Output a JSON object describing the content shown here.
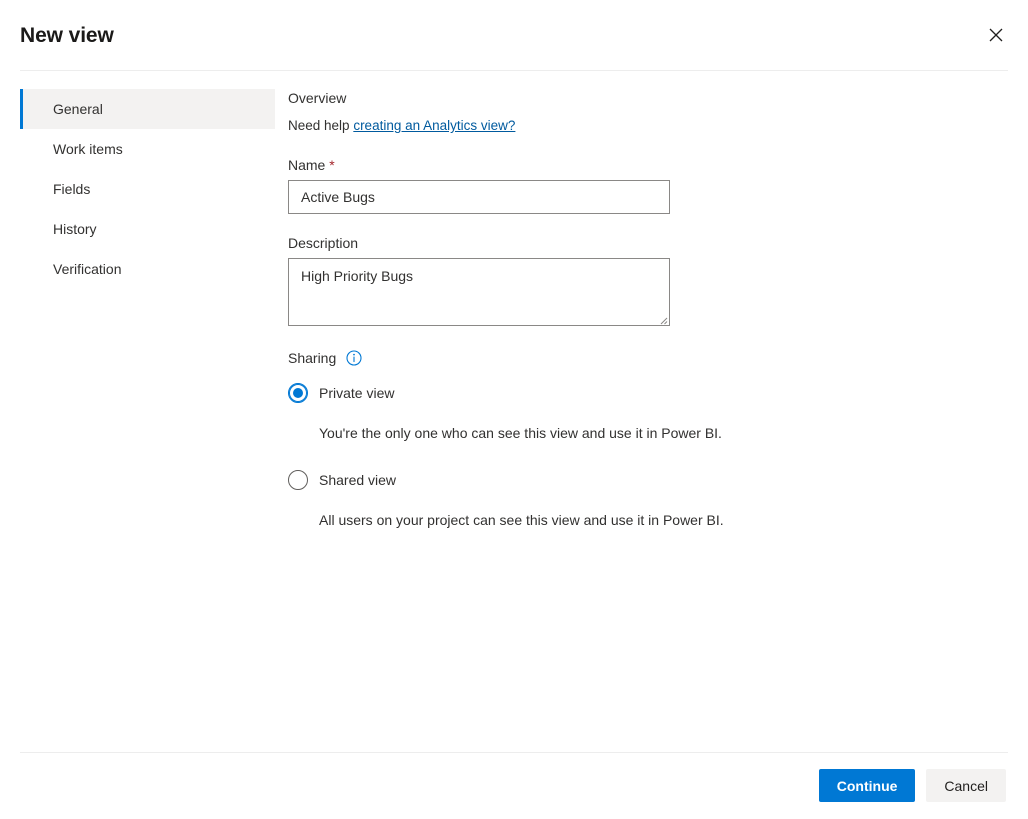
{
  "dialog": {
    "title": "New view",
    "close_icon": "close-icon"
  },
  "sidebar": {
    "items": [
      {
        "label": "General",
        "selected": true
      },
      {
        "label": "Work items",
        "selected": false
      },
      {
        "label": "Fields",
        "selected": false
      },
      {
        "label": "History",
        "selected": false
      },
      {
        "label": "Verification",
        "selected": false
      }
    ]
  },
  "main": {
    "overview_heading": "Overview",
    "help_prefix": "Need help ",
    "help_link": "creating an Analytics view?",
    "name": {
      "label": "Name",
      "required_marker": "*",
      "value": "Active Bugs",
      "placeholder": ""
    },
    "description": {
      "label": "Description",
      "value": "High Priority Bugs",
      "placeholder": ""
    },
    "sharing": {
      "label": "Sharing",
      "info_icon": "info-icon",
      "options": [
        {
          "label": "Private view",
          "selected": true,
          "description": "You're the only one who can see this view and use it in Power BI."
        },
        {
          "label": "Shared view",
          "selected": false,
          "description": "All users on your project can see this view and use it in Power BI."
        }
      ]
    }
  },
  "footer": {
    "continue_label": "Continue",
    "cancel_label": "Cancel"
  },
  "colors": {
    "accent": "#0078d4",
    "link": "#005a9e",
    "required": "#a4262c",
    "selected_nav_bg": "#f3f2f1",
    "divider": "#ededed"
  }
}
